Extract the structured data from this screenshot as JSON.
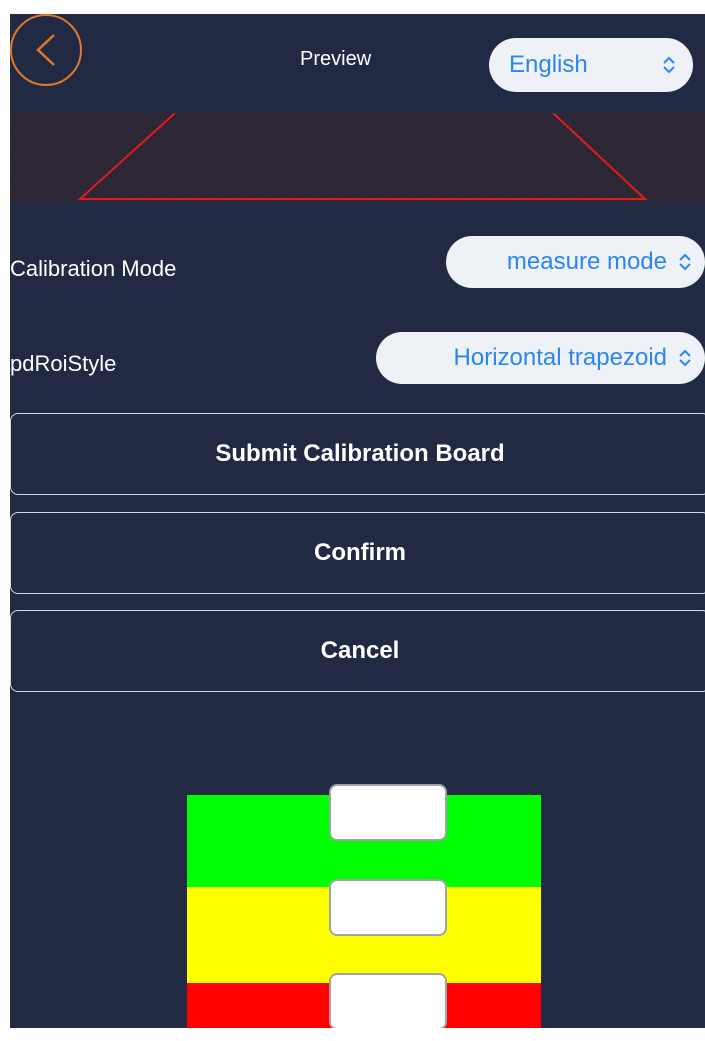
{
  "header": {
    "title": "Preview",
    "language": "English"
  },
  "settings": {
    "calibration_mode_label": "Calibration Mode",
    "calibration_mode_value": "measure mode",
    "roi_style_label": "pdRoiStyle",
    "roi_style_value": "Horizontal trapezoid"
  },
  "actions": {
    "submit_label": "Submit Calibration Board",
    "confirm_label": "Confirm",
    "cancel_label": "Cancel"
  },
  "zones": [
    {
      "name": "green-zone",
      "color": "#00ff00",
      "input_value": ""
    },
    {
      "name": "yellow-zone",
      "color": "#ffff00",
      "input_value": ""
    },
    {
      "name": "red-zone",
      "color": "#ff0000",
      "input_value": ""
    }
  ],
  "colors": {
    "background": "#222a43",
    "accent_orange": "#e0782c",
    "select_text": "#2b86f3",
    "trapezoid": "#e21b1b"
  },
  "icons": {
    "back": "chevron-left-icon",
    "select": "chevron-up-down-icon"
  }
}
